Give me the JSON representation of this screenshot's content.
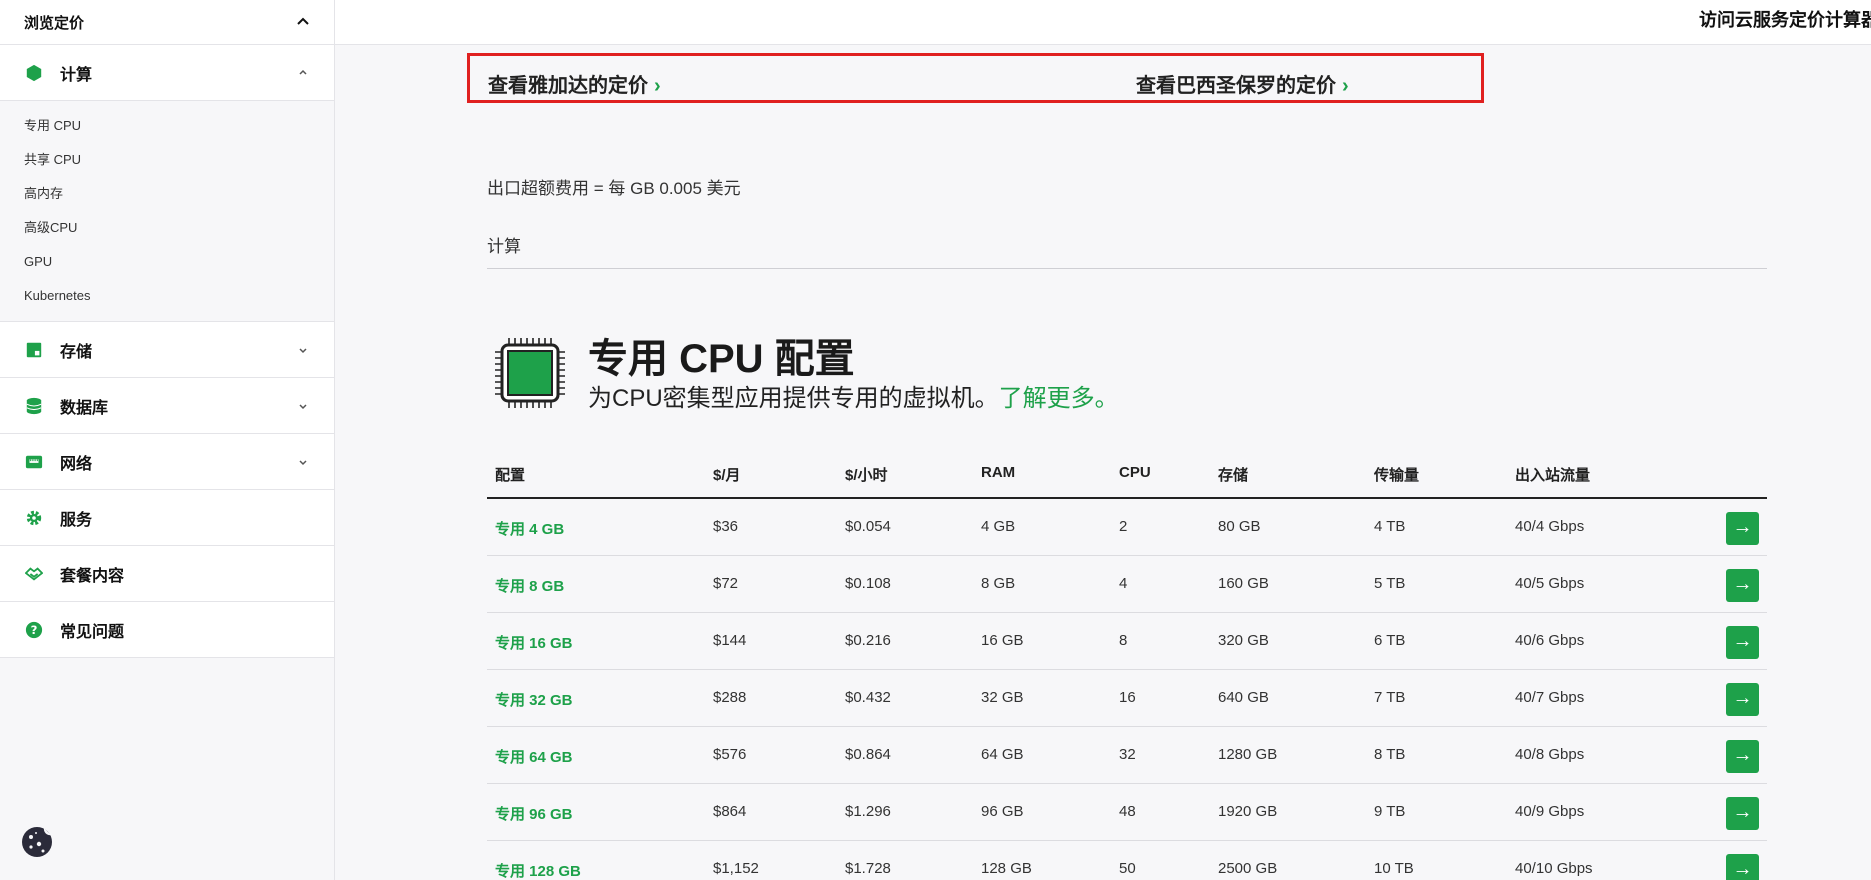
{
  "header": {
    "calculator_link": "访问云服务定价计算器"
  },
  "sidebar": {
    "title": "浏览定价",
    "sections": [
      {
        "label": "计算",
        "expanded": true,
        "icon": "hexagon-icon",
        "items": [
          "专用 CPU",
          "共享 CPU",
          "高内存",
          "高级CPU",
          "GPU",
          "Kubernetes"
        ]
      },
      {
        "label": "存储",
        "icon": "storage-icon"
      },
      {
        "label": "数据库",
        "icon": "database-icon"
      },
      {
        "label": "网络",
        "icon": "network-icon"
      },
      {
        "label": "服务",
        "icon": "gear-icon"
      },
      {
        "label": "套餐内容",
        "icon": "bundle-icon"
      },
      {
        "label": "常见问题",
        "icon": "question-icon"
      }
    ]
  },
  "locations": {
    "jakarta": "查看雅加达的定价",
    "saopaulo": "查看巴西圣保罗的定价",
    "arrow": "›"
  },
  "egress_note": "出口超额费用 = 每 GB 0.005 美元",
  "compute_label": "计算",
  "dedicated": {
    "title": "专用 CPU 配置",
    "desc": "为CPU密集型应用提供专用的虚拟机。",
    "learn_more": "了解更多。"
  },
  "table": {
    "headers": [
      "配置",
      "$/月",
      "$/小时",
      "RAM",
      "CPU",
      "存储",
      "传输量",
      "出入站流量"
    ],
    "rows": [
      [
        "专用 4 GB",
        "$36",
        "$0.054",
        "4 GB",
        "2",
        "80 GB",
        "4 TB",
        "40/4 Gbps"
      ],
      [
        "专用 8 GB",
        "$72",
        "$0.108",
        "8 GB",
        "4",
        "160 GB",
        "5 TB",
        "40/5 Gbps"
      ],
      [
        "专用 16 GB",
        "$144",
        "$0.216",
        "16 GB",
        "8",
        "320 GB",
        "6 TB",
        "40/6 Gbps"
      ],
      [
        "专用 32 GB",
        "$288",
        "$0.432",
        "32 GB",
        "16",
        "640 GB",
        "7 TB",
        "40/7 Gbps"
      ],
      [
        "专用 64 GB",
        "$576",
        "$0.864",
        "64 GB",
        "32",
        "1280 GB",
        "8 TB",
        "40/8 Gbps"
      ],
      [
        "专用 96 GB",
        "$864",
        "$1.296",
        "96 GB",
        "48",
        "1920 GB",
        "9 TB",
        "40/9 Gbps"
      ],
      [
        "专用 128 GB",
        "$1,152",
        "$1.728",
        "128 GB",
        "50",
        "2500 GB",
        "10 TB",
        "40/10 Gbps"
      ]
    ],
    "action_glyph": "→"
  },
  "colors": {
    "accent": "#1ea14a",
    "highlight": "#e02020"
  }
}
